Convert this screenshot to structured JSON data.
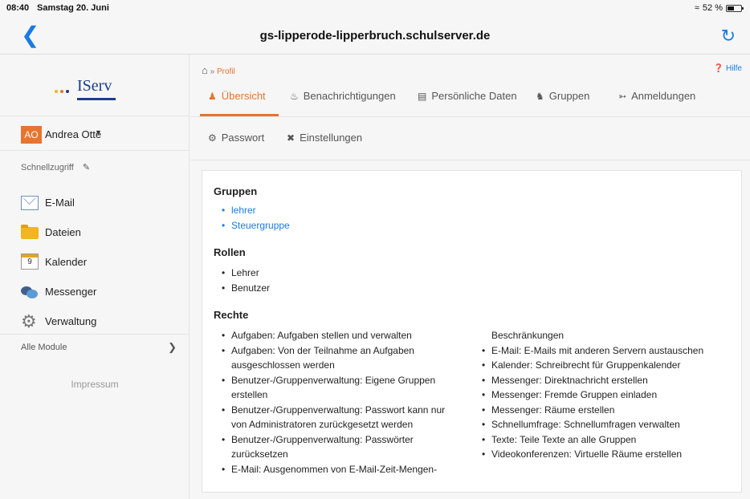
{
  "status": {
    "time": "08:40",
    "date": "Samstag 20. Juni",
    "battery": "52 %",
    "battery_level": 0.52
  },
  "browser": {
    "host": "gs-lipperode-lipperbruch.schulserver.de"
  },
  "sidebar": {
    "logo": "IServ",
    "logo_dot_colors": [
      "#f3b51d",
      "#e8742e",
      "#1d3e8a"
    ],
    "user": {
      "initials": "AO",
      "name": "Andrea Otte"
    },
    "quick_label": "Schnellzugriff",
    "items": [
      {
        "label": "E-Mail",
        "icon": "mail-icon"
      },
      {
        "label": "Dateien",
        "icon": "folder-icon"
      },
      {
        "label": "Kalender",
        "icon": "calendar-icon",
        "badge": "9"
      },
      {
        "label": "Messenger",
        "icon": "messenger-icon"
      },
      {
        "label": "Verwaltung",
        "icon": "gear-icon"
      }
    ],
    "all_modules": "Alle Module",
    "impressum": "Impressum"
  },
  "main": {
    "breadcrumb": {
      "sep": "»",
      "current": "Profil"
    },
    "help": "Hilfe",
    "tabs": [
      {
        "label": "Übersicht",
        "icon": "user-icon"
      },
      {
        "label": "Benachrichtigungen",
        "icon": "bell-icon"
      },
      {
        "label": "Persönliche Daten",
        "icon": "id-card-icon"
      },
      {
        "label": "Gruppen",
        "icon": "users-icon"
      },
      {
        "label": "Anmeldungen",
        "icon": "login-icon"
      }
    ],
    "tabs2": [
      {
        "label": "Passwort",
        "icon": "wrench-icon"
      },
      {
        "label": "Einstellungen",
        "icon": "tools-icon"
      }
    ],
    "groups_title": "Gruppen",
    "groups": [
      "lehrer",
      "Steuergruppe"
    ],
    "roles_title": "Rollen",
    "roles": [
      "Lehrer",
      "Benutzer"
    ],
    "rights_title": "Rechte",
    "rights_left": [
      "Aufgaben: Aufgaben stellen und verwalten",
      "Aufgaben: Von der Teilnahme an Aufgaben",
      "ausgeschlossen werden",
      "Benutzer-/Gruppenverwaltung: Eigene Gruppen",
      "erstellen",
      "Benutzer-/Gruppenverwaltung: Passwort kann nur",
      "von Administratoren zurückgesetzt werden",
      "Benutzer-/Gruppenverwaltung: Passwörter",
      "zurücksetzen",
      "E-Mail: Ausgenommen von E-Mail-Zeit-Mengen-"
    ],
    "rights_right": [
      "Beschränkungen",
      "E-Mail: E-Mails mit anderen Servern austauschen",
      "Kalender: Schreibrecht für Gruppenkalender",
      "Messenger: Direktnachricht erstellen",
      "Messenger: Fremde Gruppen einladen",
      "Messenger: Räume erstellen",
      "Schnellumfrage: Schnellumfragen verwalten",
      "Texte: Teile Texte an alle Gruppen",
      "Videokonferenzen: Virtuelle Räume erstellen"
    ]
  }
}
